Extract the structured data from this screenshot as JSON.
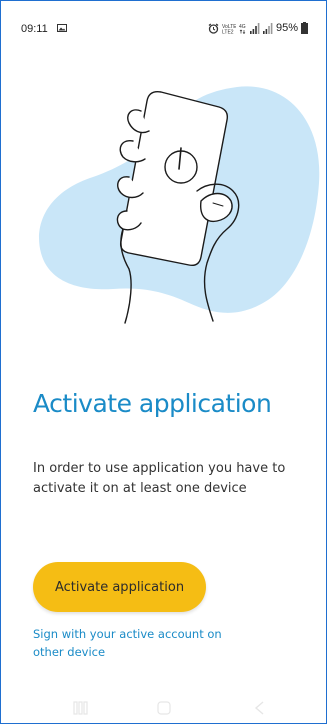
{
  "status_bar": {
    "time": "09:11",
    "battery_percent": "95%",
    "icons": [
      "gallery-icon",
      "alarm-icon",
      "volte-icon",
      "4g-icon",
      "signal-icon",
      "signal-icon",
      "battery-icon"
    ]
  },
  "illustration": {
    "description_icon": "hand-holding-phone-power-icon",
    "blob_color": "#c9e6f8"
  },
  "main": {
    "title": "Activate application",
    "description": "In order to use application you have to activate it on at least one device",
    "activate_button_label": "Activate application",
    "sign_link_label": "Sign with your active account on other device"
  },
  "colors": {
    "accent": "#1a8bc7",
    "button": "#f5bd14",
    "text": "#333333"
  },
  "nav_bar": {
    "icons": [
      "recent-apps-icon",
      "home-icon",
      "back-icon"
    ]
  }
}
